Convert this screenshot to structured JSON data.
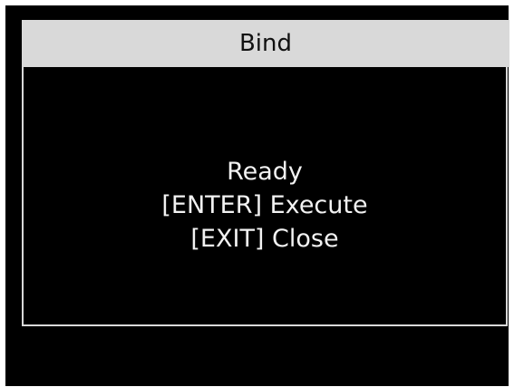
{
  "dialog": {
    "title": "Bind",
    "status": "Ready",
    "execute_hint": "[ENTER] Execute",
    "close_hint": "[EXIT] Close"
  },
  "colors": {
    "screen_background": "#000000",
    "titlebar_background": "#d9d9d9",
    "text": "#f2f2f2",
    "border": "#d9d9d9"
  }
}
